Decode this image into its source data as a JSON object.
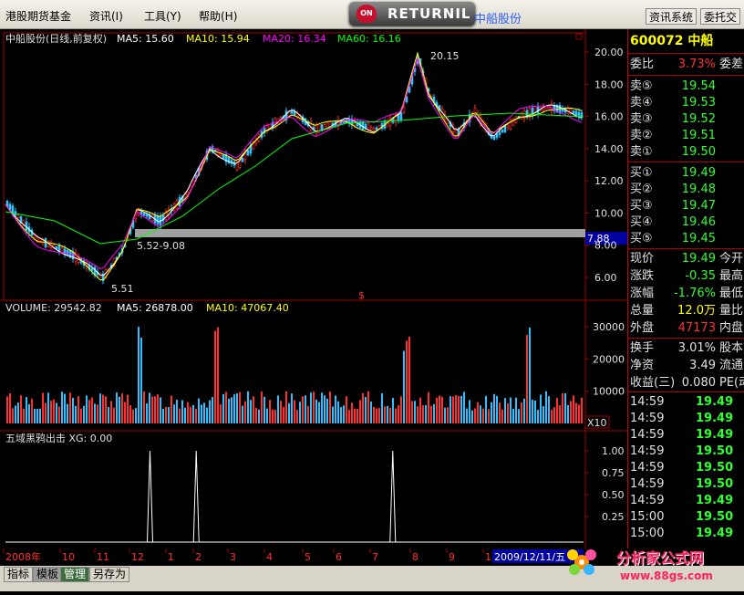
{
  "menu": {
    "items": [
      "港股期货基金",
      "资讯(I)",
      "工具(Y)",
      "帮助(H)"
    ],
    "right_buttons": [
      "资讯系统",
      "委托交"
    ],
    "badge_text": "RETURNIL",
    "badge_icon": "ON",
    "stock_title": "中船股份"
  },
  "main_chart": {
    "header": "中船股份(日线,前复权)",
    "ma": [
      {
        "label": "MA5: 15.60",
        "color": "#ffffff"
      },
      {
        "label": "MA10: 15.94",
        "color": "#ffff00"
      },
      {
        "label": "MA20: 16.34",
        "color": "#ff00ff"
      },
      {
        "label": "MA60: 16.16",
        "color": "#00ff00"
      }
    ],
    "y_ticks": [
      "20.00",
      "18.00",
      "16.00",
      "14.00",
      "12.00",
      "10.00",
      "8.00",
      "6.00"
    ],
    "current_price_tag": "7.88",
    "annotations": {
      "high": "20.15",
      "low": "5.51",
      "range": "5.52-9.08",
      "dollar": "$"
    }
  },
  "volume_chart": {
    "header": "VOLUME: 29542.82",
    "ma": [
      {
        "label": "MA5: 26878.00",
        "color": "#ffffff"
      },
      {
        "label": "MA10: 47067.40",
        "color": "#ffff00"
      }
    ],
    "y_ticks": [
      "30000",
      "20000",
      "10000"
    ],
    "unit_tag": "X10"
  },
  "indicator_chart": {
    "header": "五域黑鸦出击  XG: 0.00",
    "y_ticks": [
      "1.00",
      "0.75",
      "0.50",
      "0.25"
    ]
  },
  "time_axis": {
    "labels": [
      "2008年",
      "10",
      "11",
      "12",
      "1",
      "2",
      "3",
      "4",
      "5",
      "6",
      "7",
      "8",
      "9",
      "1"
    ],
    "date_tag": "2009/12/11/五"
  },
  "info_panel": {
    "code_name": "600072 中船",
    "weibi": {
      "label": "委比",
      "value": "3.73%",
      "extra": "委差"
    },
    "asks": [
      {
        "label": "卖⑤",
        "price": "19.54"
      },
      {
        "label": "卖④",
        "price": "19.53"
      },
      {
        "label": "卖③",
        "price": "19.52"
      },
      {
        "label": "卖②",
        "price": "19.51"
      },
      {
        "label": "卖①",
        "price": "19.50"
      }
    ],
    "bids": [
      {
        "label": "买①",
        "price": "19.49"
      },
      {
        "label": "买②",
        "price": "19.48"
      },
      {
        "label": "买③",
        "price": "19.47"
      },
      {
        "label": "买④",
        "price": "19.46"
      },
      {
        "label": "买⑤",
        "price": "19.45"
      }
    ],
    "quote": [
      {
        "label": "现价",
        "value": "19.49",
        "extra": "今开",
        "color": "#30ff30"
      },
      {
        "label": "涨跌",
        "value": "-0.35",
        "extra": "最高",
        "color": "#30ff30"
      },
      {
        "label": "涨幅",
        "value": "-1.76%",
        "extra": "最低",
        "color": "#30ff30"
      },
      {
        "label": "总量",
        "value": "12.0万",
        "extra": "量比",
        "color": "#ffff00"
      },
      {
        "label": "外盘",
        "value": "47173",
        "extra": "内盘",
        "color": "#ff3030"
      }
    ],
    "stats": [
      {
        "label": "换手",
        "value": "3.01%",
        "extra": "股本",
        "color": "#e0e0e0"
      },
      {
        "label": "净资",
        "value": "3.49",
        "extra": "流通",
        "color": "#e0e0e0"
      },
      {
        "label": "收益(三)",
        "value": "0.080",
        "extra": "PE(动",
        "color": "#e0e0e0"
      }
    ],
    "ticks": [
      {
        "time": "14:59",
        "price": "19.49"
      },
      {
        "time": "14:59",
        "price": "19.49"
      },
      {
        "time": "14:59",
        "price": "19.49"
      },
      {
        "time": "14:59",
        "price": "19.50"
      },
      {
        "time": "14:59",
        "price": "19.50"
      },
      {
        "time": "14:59",
        "price": "19.50"
      },
      {
        "time": "14:59",
        "price": "19.49"
      },
      {
        "time": "15:00",
        "price": "19.50"
      },
      {
        "time": "15:00",
        "price": "19.49"
      }
    ]
  },
  "bottom_tabs": [
    "指标",
    "模板",
    "管理",
    "另存为"
  ],
  "logo": {
    "title": "分析家公式网",
    "url": "www.88gs.com"
  },
  "indicator_signals": [
    0.25,
    0.33,
    0.67
  ],
  "colors": {
    "up": "#ff3030",
    "down": "#30ff30",
    "accent": "#3060ff",
    "highlight_bar": "#a0a0a0"
  }
}
